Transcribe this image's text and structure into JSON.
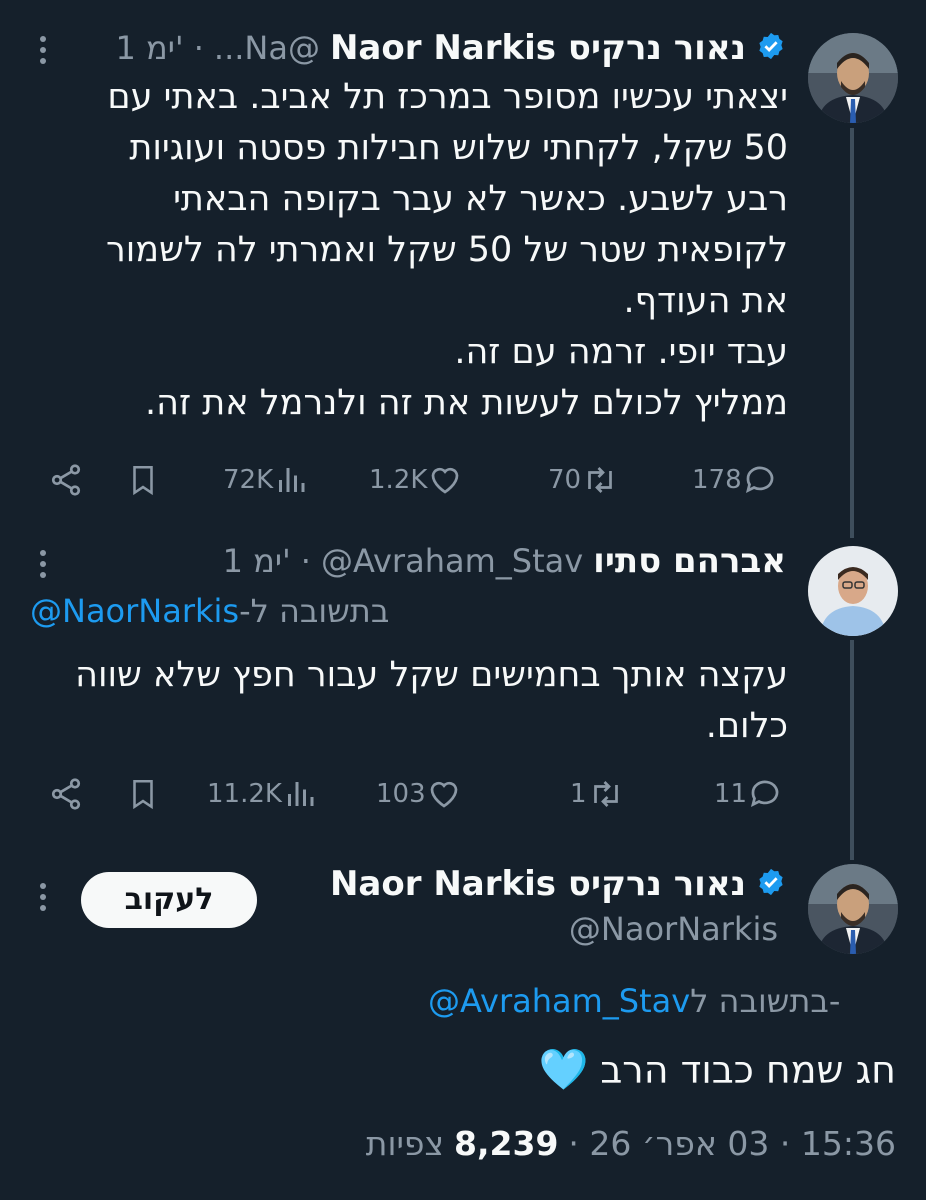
{
  "tweet1": {
    "display_name": "Naor Narkis נאור נרקיס",
    "handle_truncated": "...Na@",
    "time": "1 ימ'",
    "text_lines": [
      "יצאתי עכשיו מסופר במרכז תל אביב. באתי עם",
      "50 שקל, לקחתי שלוש חבילות פסטה ועוגיות",
      "רבע לשבע. כאשר לא עבר בקופה הבאתי",
      "לקופאית שטר של 50 שקל ואמרתי לה לשמור",
      "את העודף.",
      "עבד יופי. זרמה עם זה.",
      "ממליץ לכולם לעשות את זה ולנרמל את זה."
    ],
    "replies": "178",
    "retweets": "70",
    "likes": "1.2K",
    "views": "72K"
  },
  "tweet2": {
    "display_name": "אברהם סתיו",
    "handle": "@Avraham_Stav",
    "time": "1 ימ'",
    "reply_prefix": "בתשובה ל-",
    "reply_to": "@NaorNarkis",
    "text_lines": [
      "עקצה אותך בחמישים שקל עבור חפץ שלא שווה",
      "כלום."
    ],
    "replies": "11",
    "retweets": "1",
    "likes": "103",
    "views": "11.2K"
  },
  "tweet3": {
    "display_name": "Naor Narkis נאור נרקיס",
    "handle": "@NaorNarkis",
    "follow_label": "לעקוב",
    "reply_prefix": "בתשובה ל-",
    "reply_to": "@Avraham_Stav",
    "text": "חג שמח כבוד הרב",
    "emoji": "🩵",
    "timestamp": "15:36 · 03 אפר׳ 26 ·",
    "view_count": "8,239",
    "views_label": "צפיות"
  },
  "icons": [
    "verified-badge-icon",
    "more-icon",
    "reply-icon",
    "retweet-icon",
    "like-icon",
    "views-icon",
    "bookmark-icon",
    "share-icon"
  ],
  "colors": {
    "background": "#15202b",
    "text": "#f7f9f9",
    "muted": "#8b98a5",
    "link": "#1d9bf0",
    "verified": "#1d9bf0",
    "thread_line": "#3e4e5c"
  }
}
